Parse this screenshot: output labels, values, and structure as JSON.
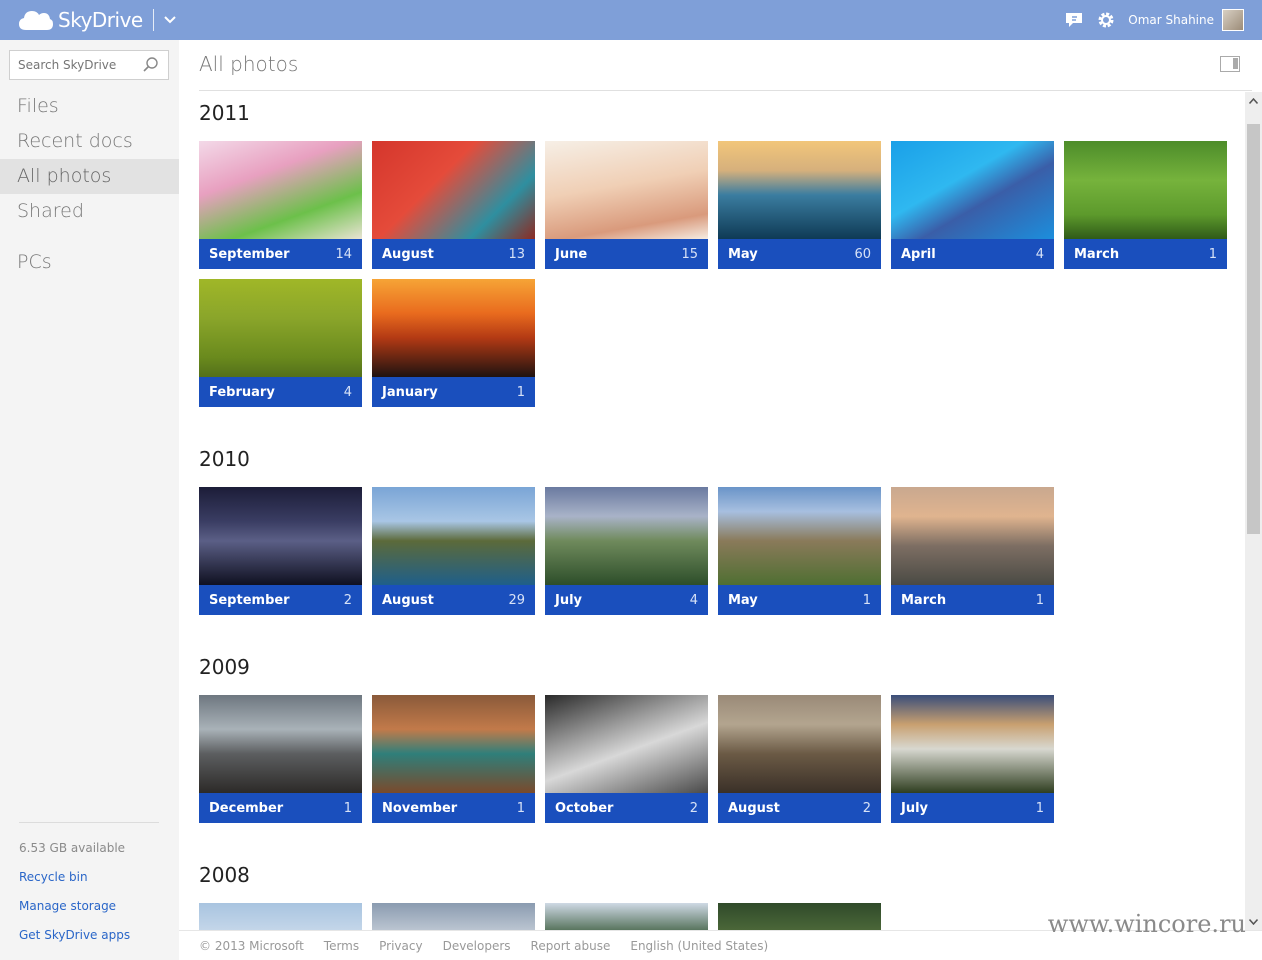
{
  "header": {
    "app_name": "SkyDrive",
    "user_name": "Omar Shahine",
    "brand_color": "#7f9fd8",
    "icons": [
      "cloud-logo-icon",
      "chevron-down-icon",
      "chat-icon",
      "gear-icon",
      "avatar"
    ]
  },
  "sidebar": {
    "search_placeholder": "Search SkyDrive",
    "items": [
      {
        "label": "Files"
      },
      {
        "label": "Recent docs"
      },
      {
        "label": "All photos",
        "active": true
      },
      {
        "label": "Shared"
      },
      {
        "label": "PCs"
      }
    ],
    "storage": "6.53 GB available",
    "links": [
      "Recycle bin",
      "Manage storage",
      "Get SkyDrive apps"
    ]
  },
  "main": {
    "title": "All photos",
    "accent_color": "#1a4fbd",
    "years": [
      {
        "year": "2011",
        "albums": [
          {
            "month": "September",
            "count": "14"
          },
          {
            "month": "August",
            "count": "13"
          },
          {
            "month": "June",
            "count": "15"
          },
          {
            "month": "May",
            "count": "60"
          },
          {
            "month": "April",
            "count": "4"
          },
          {
            "month": "March",
            "count": "1"
          },
          {
            "month": "February",
            "count": "4"
          },
          {
            "month": "January",
            "count": "1"
          }
        ]
      },
      {
        "year": "2010",
        "albums": [
          {
            "month": "September",
            "count": "2"
          },
          {
            "month": "August",
            "count": "29"
          },
          {
            "month": "July",
            "count": "4"
          },
          {
            "month": "May",
            "count": "1"
          },
          {
            "month": "March",
            "count": "1"
          }
        ]
      },
      {
        "year": "2009",
        "albums": [
          {
            "month": "December",
            "count": "1"
          },
          {
            "month": "November",
            "count": "1"
          },
          {
            "month": "October",
            "count": "2"
          },
          {
            "month": "August",
            "count": "2"
          },
          {
            "month": "July",
            "count": "1"
          }
        ]
      },
      {
        "year": "2008",
        "albums": []
      }
    ]
  },
  "footer": {
    "copyright": "© 2013 Microsoft",
    "links": [
      "Terms",
      "Privacy",
      "Developers",
      "Report abuse",
      "English (United States)"
    ]
  },
  "watermark": "www.wincore.ru"
}
